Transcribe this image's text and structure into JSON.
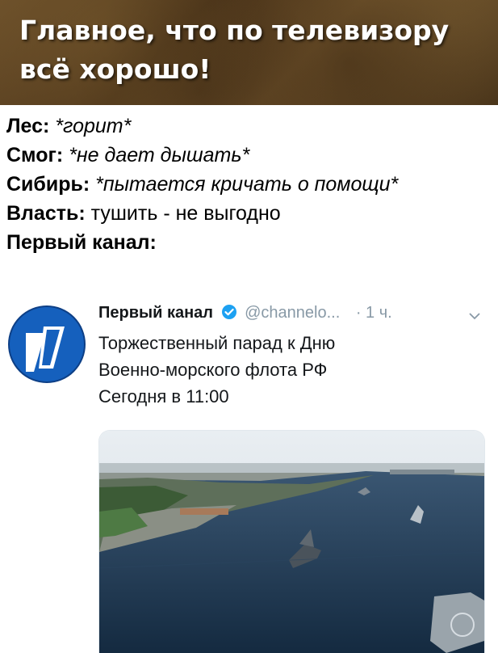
{
  "banner": {
    "line1": "Главное, что по телевизору",
    "line2": "всё хорошо!"
  },
  "lines": [
    {
      "key": "Лес:",
      "value": "*горит*"
    },
    {
      "key": "Смог:",
      "value": "*не дает дышать*"
    },
    {
      "key": "Сибирь:",
      "value": "*пытается кричать о помощи*"
    },
    {
      "key": "Власть:",
      "value": "тушить - не выгодно"
    },
    {
      "key": "Первый канал:",
      "value": ""
    }
  ],
  "tweet": {
    "author": "Первый канал",
    "handle": "@channelo...",
    "time": "· 1 ч.",
    "text_line1": "Торжественный парад к Дню",
    "text_line2": "Военно-морского флота РФ",
    "text_line3": "Сегодня в 11:00"
  },
  "colors": {
    "accent": "#1da1f2",
    "logo_blue": "#1560bd",
    "water": "#1e3550"
  },
  "icons": {
    "verified": "verified-badge-icon",
    "chevron": "chevron-down-icon"
  }
}
